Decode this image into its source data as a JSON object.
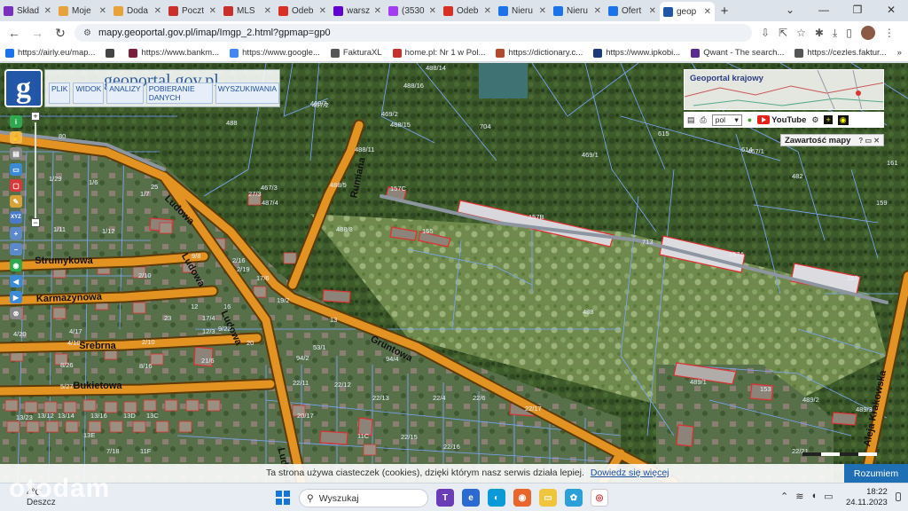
{
  "browser": {
    "tabs": [
      {
        "label": "Skład",
        "icon": "onet-icon",
        "color": "#7b2fbe"
      },
      {
        "label": "Moje",
        "icon": "bookmark-e-icon",
        "color": "#e7a23a"
      },
      {
        "label": "Doda",
        "icon": "bookmark-e-icon",
        "color": "#e7a23a"
      },
      {
        "label": "Poczt",
        "icon": "pdf-icon",
        "color": "#c9302c"
      },
      {
        "label": "MLS",
        "icon": "mls-icon",
        "color": "#c9302c"
      },
      {
        "label": "Odeb",
        "icon": "gmail-icon",
        "color": "#d93025"
      },
      {
        "label": "warsz",
        "icon": "yahoo-icon",
        "color": "#6001d2"
      },
      {
        "label": "(3530",
        "icon": "messenger-icon",
        "color": "#a43cf4"
      },
      {
        "label": "Odeb",
        "icon": "gmail-icon",
        "color": "#d93025"
      },
      {
        "label": "Nieru",
        "icon": "search-icon",
        "color": "#1a73e8"
      },
      {
        "label": "Nieru",
        "icon": "search-icon",
        "color": "#1a73e8"
      },
      {
        "label": "Ofert",
        "icon": "search-icon",
        "color": "#1a73e8"
      },
      {
        "label": "geop",
        "icon": "geoportal-icon",
        "color": "#2257a8",
        "active": true
      }
    ],
    "new_tab": "+",
    "url": "mapy.geoportal.gov.pl/imap/Imgp_2.html?gpmap=gp0"
  },
  "bookmarks": [
    {
      "label": "https://airly.eu/map...",
      "color": "#1a73e8"
    },
    {
      "label": "",
      "color": "#444"
    },
    {
      "label": "https://www.bankm...",
      "color": "#7b1e3c"
    },
    {
      "label": "https://www.google...",
      "color": "#4285f4"
    },
    {
      "label": "FakturaXL",
      "color": "#555"
    },
    {
      "label": "home.pl: Nr 1 w Pol...",
      "color": "#c9302c"
    },
    {
      "label": "https://dictionary.c...",
      "color": "#b04a2a"
    },
    {
      "label": "https://www.ipkobi...",
      "color": "#1a3a7a"
    },
    {
      "label": "Qwant - The search...",
      "color": "#5c2d91"
    },
    {
      "label": "https://cezles.faktur...",
      "color": "#555"
    }
  ],
  "bookmarks_overflow": "»",
  "bookmarks_folder": "Wszystkie zakładki",
  "geoportal": {
    "title": "geoportal.gov.pl",
    "logo": "g",
    "menu": [
      "PLIK",
      "WIDOK",
      "ANALIZY",
      "POBIERANIE DANYCH",
      "WYSZUKIWANIA"
    ],
    "krajowy_label": "Geoportal krajowy",
    "language": "pol",
    "youtube": "YouTube",
    "zawartosc": "Zawartość mapy",
    "zawartosc_controls": "? ▭ ✕"
  },
  "map": {
    "streets": [
      {
        "name": "Strumykowa"
      },
      {
        "name": "Karmazynowa"
      },
      {
        "name": "Srebrna"
      },
      {
        "name": "Bukietowa"
      },
      {
        "name": "Gruntowa"
      },
      {
        "name": "Rumiana"
      },
      {
        "name": "Ludowa"
      },
      {
        "name": "Ludowa"
      },
      {
        "name": "Aleja Krakowska"
      },
      {
        "name": "Ludowa"
      },
      {
        "name": "Ludowa"
      }
    ],
    "parcels": [
      "488/14",
      "488/16",
      "469/3",
      "469/2",
      "488/15",
      "487/2",
      "488",
      "704",
      "615",
      "469/1",
      "467/1",
      "614",
      "488/11",
      "161",
      "80",
      "488/5",
      "467/3",
      "487/4",
      "157C",
      "482",
      "159",
      "1/29",
      "1/6",
      "1/7",
      "25",
      "27/3",
      "157B",
      "1/11",
      "1/12",
      "9/8",
      "155",
      "488/8",
      "713",
      "157A",
      "2/16",
      "157",
      "2/19",
      "2/10",
      "17/6",
      "19/2",
      "12",
      "16",
      "4/10",
      "2/10",
      "23",
      "17/4",
      "488",
      "9/22",
      "4/20",
      "4/17",
      "12/3",
      "20",
      "13",
      "53/1",
      "8/26",
      "8/16",
      "5/27",
      "21/6",
      "94/2",
      "94/4",
      "22/11",
      "22/12",
      "22/13",
      "22/4",
      "22/6",
      "489/1",
      "153",
      "489/2",
      "22/17",
      "20/17",
      "489/3",
      "13/23",
      "13/12",
      "13/14",
      "13/16",
      "13E",
      "13D",
      "13C",
      "7/18",
      "11F",
      "11C",
      "22/15",
      "22/16",
      "22/21",
      "488/2"
    ]
  },
  "cookie": {
    "text": "Ta strona używa ciasteczek (cookies), dzięki którym nasz serwis działa lepiej.",
    "link": "Dowiedz się więcej",
    "button": "Rozumiem"
  },
  "taskbar": {
    "search_placeholder": "Wyszukaj",
    "pinned_line1": "4°C",
    "pinned_line2": "Deszcz",
    "time": "18:22",
    "date": "24.11.2023",
    "badges": [
      "1",
      "1"
    ]
  },
  "watermark": "otodam",
  "colors": {
    "road": "#e39322",
    "road_edge": "#5c3b08",
    "parcel_line": "#7aa6ff",
    "building_outline": "#e03030",
    "map_dark": "#3e5a2c"
  }
}
